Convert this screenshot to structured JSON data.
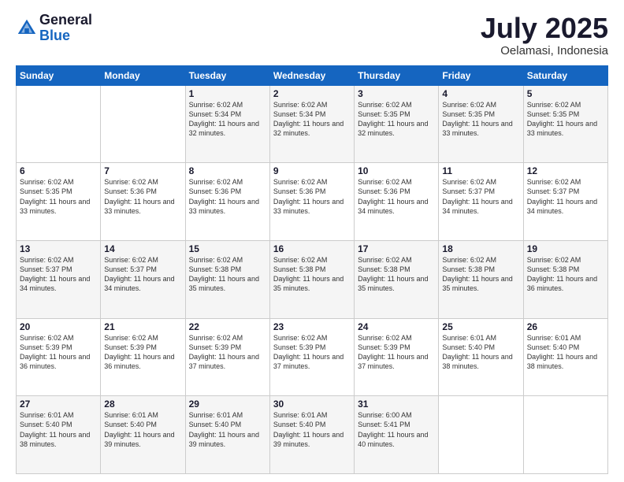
{
  "logo": {
    "general": "General",
    "blue": "Blue"
  },
  "header": {
    "month": "July 2025",
    "location": "Oelamasi, Indonesia"
  },
  "weekdays": [
    "Sunday",
    "Monday",
    "Tuesday",
    "Wednesday",
    "Thursday",
    "Friday",
    "Saturday"
  ],
  "weeks": [
    [
      {
        "day": "",
        "info": ""
      },
      {
        "day": "",
        "info": ""
      },
      {
        "day": "1",
        "info": "Sunrise: 6:02 AM\nSunset: 5:34 PM\nDaylight: 11 hours and 32 minutes."
      },
      {
        "day": "2",
        "info": "Sunrise: 6:02 AM\nSunset: 5:34 PM\nDaylight: 11 hours and 32 minutes."
      },
      {
        "day": "3",
        "info": "Sunrise: 6:02 AM\nSunset: 5:35 PM\nDaylight: 11 hours and 32 minutes."
      },
      {
        "day": "4",
        "info": "Sunrise: 6:02 AM\nSunset: 5:35 PM\nDaylight: 11 hours and 33 minutes."
      },
      {
        "day": "5",
        "info": "Sunrise: 6:02 AM\nSunset: 5:35 PM\nDaylight: 11 hours and 33 minutes."
      }
    ],
    [
      {
        "day": "6",
        "info": "Sunrise: 6:02 AM\nSunset: 5:35 PM\nDaylight: 11 hours and 33 minutes."
      },
      {
        "day": "7",
        "info": "Sunrise: 6:02 AM\nSunset: 5:36 PM\nDaylight: 11 hours and 33 minutes."
      },
      {
        "day": "8",
        "info": "Sunrise: 6:02 AM\nSunset: 5:36 PM\nDaylight: 11 hours and 33 minutes."
      },
      {
        "day": "9",
        "info": "Sunrise: 6:02 AM\nSunset: 5:36 PM\nDaylight: 11 hours and 33 minutes."
      },
      {
        "day": "10",
        "info": "Sunrise: 6:02 AM\nSunset: 5:36 PM\nDaylight: 11 hours and 34 minutes."
      },
      {
        "day": "11",
        "info": "Sunrise: 6:02 AM\nSunset: 5:37 PM\nDaylight: 11 hours and 34 minutes."
      },
      {
        "day": "12",
        "info": "Sunrise: 6:02 AM\nSunset: 5:37 PM\nDaylight: 11 hours and 34 minutes."
      }
    ],
    [
      {
        "day": "13",
        "info": "Sunrise: 6:02 AM\nSunset: 5:37 PM\nDaylight: 11 hours and 34 minutes."
      },
      {
        "day": "14",
        "info": "Sunrise: 6:02 AM\nSunset: 5:37 PM\nDaylight: 11 hours and 34 minutes."
      },
      {
        "day": "15",
        "info": "Sunrise: 6:02 AM\nSunset: 5:38 PM\nDaylight: 11 hours and 35 minutes."
      },
      {
        "day": "16",
        "info": "Sunrise: 6:02 AM\nSunset: 5:38 PM\nDaylight: 11 hours and 35 minutes."
      },
      {
        "day": "17",
        "info": "Sunrise: 6:02 AM\nSunset: 5:38 PM\nDaylight: 11 hours and 35 minutes."
      },
      {
        "day": "18",
        "info": "Sunrise: 6:02 AM\nSunset: 5:38 PM\nDaylight: 11 hours and 35 minutes."
      },
      {
        "day": "19",
        "info": "Sunrise: 6:02 AM\nSunset: 5:38 PM\nDaylight: 11 hours and 36 minutes."
      }
    ],
    [
      {
        "day": "20",
        "info": "Sunrise: 6:02 AM\nSunset: 5:39 PM\nDaylight: 11 hours and 36 minutes."
      },
      {
        "day": "21",
        "info": "Sunrise: 6:02 AM\nSunset: 5:39 PM\nDaylight: 11 hours and 36 minutes."
      },
      {
        "day": "22",
        "info": "Sunrise: 6:02 AM\nSunset: 5:39 PM\nDaylight: 11 hours and 37 minutes."
      },
      {
        "day": "23",
        "info": "Sunrise: 6:02 AM\nSunset: 5:39 PM\nDaylight: 11 hours and 37 minutes."
      },
      {
        "day": "24",
        "info": "Sunrise: 6:02 AM\nSunset: 5:39 PM\nDaylight: 11 hours and 37 minutes."
      },
      {
        "day": "25",
        "info": "Sunrise: 6:01 AM\nSunset: 5:40 PM\nDaylight: 11 hours and 38 minutes."
      },
      {
        "day": "26",
        "info": "Sunrise: 6:01 AM\nSunset: 5:40 PM\nDaylight: 11 hours and 38 minutes."
      }
    ],
    [
      {
        "day": "27",
        "info": "Sunrise: 6:01 AM\nSunset: 5:40 PM\nDaylight: 11 hours and 38 minutes."
      },
      {
        "day": "28",
        "info": "Sunrise: 6:01 AM\nSunset: 5:40 PM\nDaylight: 11 hours and 39 minutes."
      },
      {
        "day": "29",
        "info": "Sunrise: 6:01 AM\nSunset: 5:40 PM\nDaylight: 11 hours and 39 minutes."
      },
      {
        "day": "30",
        "info": "Sunrise: 6:01 AM\nSunset: 5:40 PM\nDaylight: 11 hours and 39 minutes."
      },
      {
        "day": "31",
        "info": "Sunrise: 6:00 AM\nSunset: 5:41 PM\nDaylight: 11 hours and 40 minutes."
      },
      {
        "day": "",
        "info": ""
      },
      {
        "day": "",
        "info": ""
      }
    ]
  ]
}
